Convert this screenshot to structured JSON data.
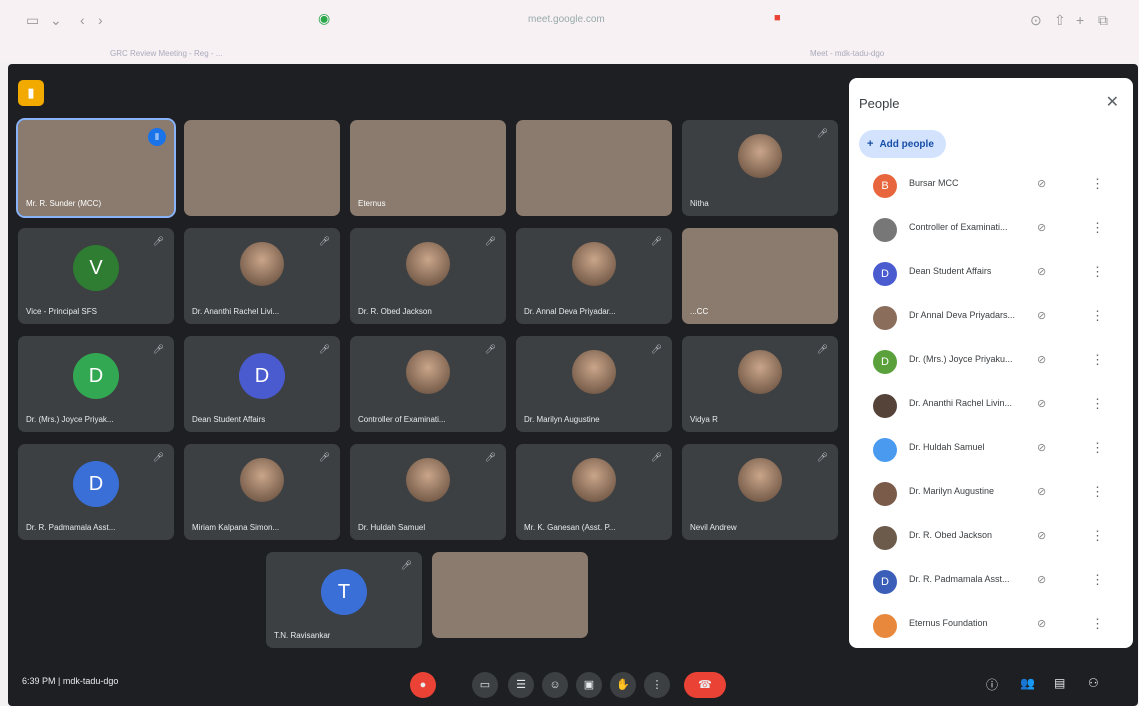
{
  "browser": {
    "url": "meet.google.com",
    "bookmark1": "GRC Review Meeting - Reg - ...",
    "bookmark2": "Meet - mdk-tadu-dgo"
  },
  "panel": {
    "title": "People",
    "add_label": "Add people"
  },
  "tiles": [
    {
      "name": "Mr. R. Sunder (MCC)",
      "type": "video"
    },
    {
      "name": "",
      "type": "video"
    },
    {
      "name": "Eternus",
      "type": "video"
    },
    {
      "name": "",
      "type": "video"
    },
    {
      "name": "Nitha",
      "type": "photo"
    },
    {
      "name": "Vice - Principal SFS",
      "type": "letter",
      "letter": "V",
      "color": "#2e7d32"
    },
    {
      "name": "Dr. Ananthi Rachel Livi...",
      "type": "photo"
    },
    {
      "name": "Dr. R. Obed Jackson",
      "type": "photo"
    },
    {
      "name": "Dr. Annal Deva Priyadar...",
      "type": "photo"
    },
    {
      "name": "...CC",
      "type": "video"
    },
    {
      "name": "Dr. (Mrs.) Joyce Priyak...",
      "type": "letter",
      "letter": "D",
      "color": "#33a852"
    },
    {
      "name": "Dean Student Affairs",
      "type": "letter",
      "letter": "D",
      "color": "#4a5bd0"
    },
    {
      "name": "Controller of Examinati...",
      "type": "photo"
    },
    {
      "name": "Dr. Marilyn Augustine",
      "type": "photo"
    },
    {
      "name": "Vidya R",
      "type": "photo"
    },
    {
      "name": "Dr. R. Padmamala Asst...",
      "type": "letter",
      "letter": "D",
      "color": "#3b6fd8"
    },
    {
      "name": "Miriam Kalpana Simon...",
      "type": "photo"
    },
    {
      "name": "Dr. Huldah Samuel",
      "type": "photo"
    },
    {
      "name": "Mr. K. Ganesan (Asst. P...",
      "type": "photo"
    },
    {
      "name": "Nevil Andrew",
      "type": "photo"
    },
    {
      "name": "T.N. Ravisankar",
      "type": "letter",
      "letter": "T",
      "color": "#3b6fd8"
    },
    {
      "name": "",
      "type": "video"
    }
  ],
  "people": [
    {
      "name": "Bursar MCC",
      "initial": "B",
      "color": "#e8663d"
    },
    {
      "name": "Controller of Examinati...",
      "initial": "",
      "color": "#777"
    },
    {
      "name": "Dean Student Affairs",
      "initial": "D",
      "color": "#4a5bd0"
    },
    {
      "name": "Dr Annal Deva Priyadars...",
      "initial": "",
      "color": "#8a6d5a"
    },
    {
      "name": "Dr. (Mrs.) Joyce Priyaku...",
      "initial": "D",
      "color": "#5aa13c"
    },
    {
      "name": "Dr. Ananthi Rachel Livin...",
      "initial": "",
      "color": "#55433a"
    },
    {
      "name": "Dr. Huldah Samuel",
      "initial": "",
      "color": "#4a9af0"
    },
    {
      "name": "Dr. Marilyn Augustine",
      "initial": "",
      "color": "#7a5a48"
    },
    {
      "name": "Dr. R. Obed Jackson",
      "initial": "",
      "color": "#6c5a4a"
    },
    {
      "name": "Dr. R. Padmamala Asst...",
      "initial": "D",
      "color": "#3b5fb8"
    },
    {
      "name": "Eternus Foundation",
      "initial": "",
      "color": "#e8883d"
    }
  ],
  "bottom": {
    "time": "6:39 PM",
    "code": "mdk-tadu-dgo"
  }
}
